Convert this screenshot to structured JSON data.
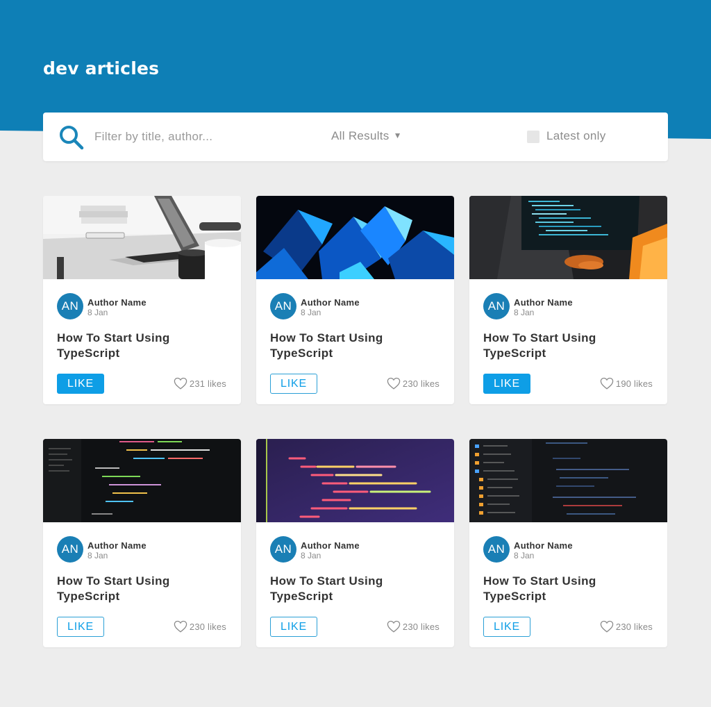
{
  "app": {
    "brand": "dev articles",
    "accent_color": "#0e9ee6",
    "header_color": "#0e7fb6"
  },
  "filters": {
    "search_placeholder": "Filter by title, author...",
    "results_label": "All Results",
    "latest_label": "Latest only",
    "latest_checked": false
  },
  "articles": [
    {
      "author_initials": "AN",
      "author_name": "Author Name",
      "date": "8 Jan",
      "title": "How To Start Using TypeScript",
      "like_label": "LIKE",
      "liked": true,
      "likes": "231 likes",
      "image": "laptop-desk"
    },
    {
      "author_initials": "AN",
      "author_name": "Author Name",
      "date": "8 Jan",
      "title": "How To Start Using TypeScript",
      "like_label": "LIKE",
      "liked": false,
      "likes": "230 likes",
      "image": "blue-crystals"
    },
    {
      "author_initials": "AN",
      "author_name": "Author Name",
      "date": "8 Jan",
      "title": "How To Start Using TypeScript",
      "like_label": "LIKE",
      "liked": true,
      "likes": "190 likes",
      "image": "typing-at-monitor"
    },
    {
      "author_initials": "AN",
      "author_name": "Author Name",
      "date": "8 Jan",
      "title": "How To Start Using TypeScript",
      "like_label": "LIKE",
      "liked": false,
      "likes": "230 likes",
      "image": "dark-code-editor"
    },
    {
      "author_initials": "AN",
      "author_name": "Author Name",
      "date": "8 Jan",
      "title": "How To Start Using TypeScript",
      "like_label": "LIKE",
      "liked": false,
      "likes": "230 likes",
      "image": "jsx-code-purple"
    },
    {
      "author_initials": "AN",
      "author_name": "Author Name",
      "date": "8 Jan",
      "title": "How To Start Using TypeScript",
      "like_label": "LIKE",
      "liked": false,
      "likes": "230 likes",
      "image": "code-file-tree"
    }
  ]
}
